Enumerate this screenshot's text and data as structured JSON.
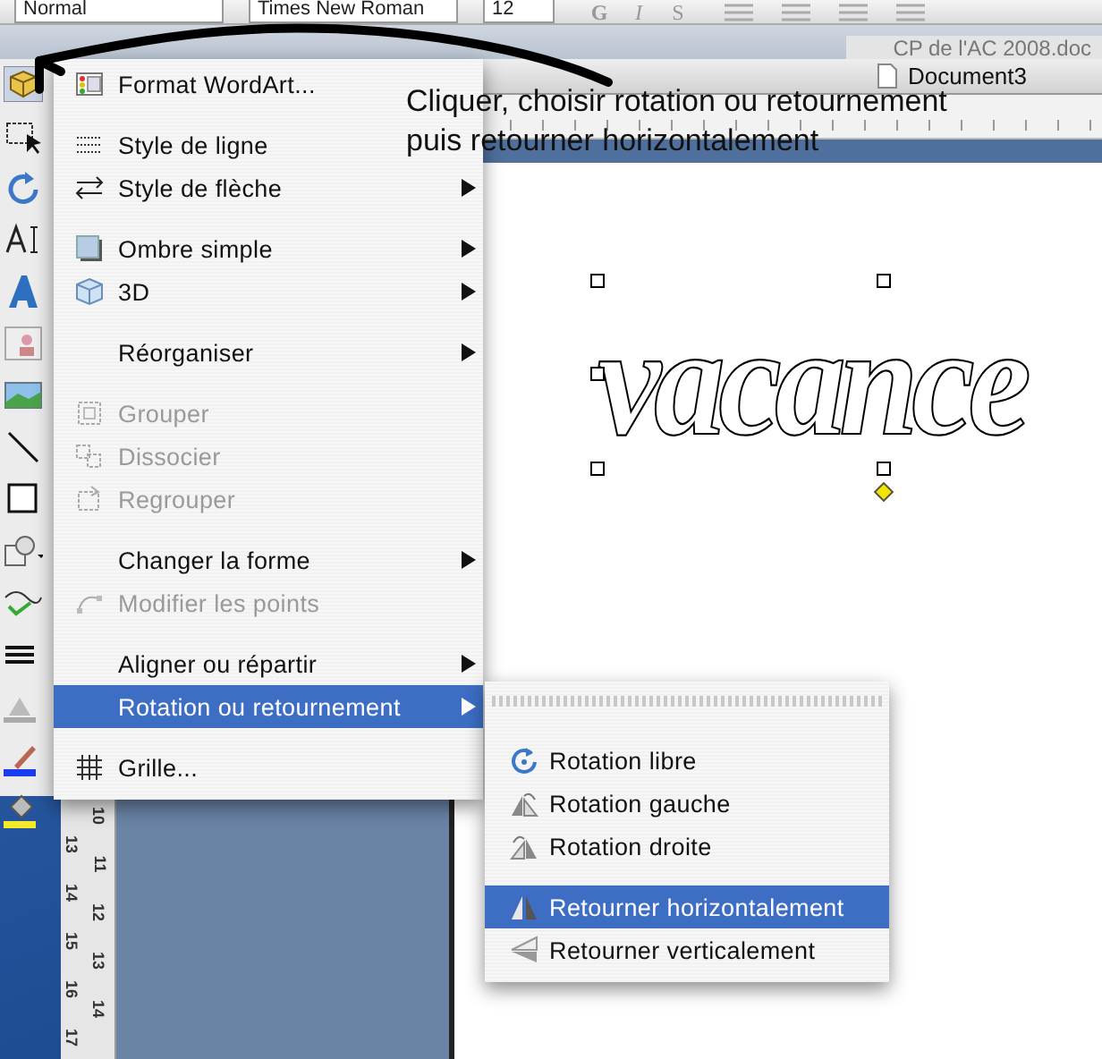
{
  "toolbar": {
    "style_field": "Normal",
    "font_field": "Times New Roman",
    "size_field": "12",
    "format_buttons": [
      "G",
      "I",
      "S"
    ]
  },
  "back_window": {
    "title": "CP de l'AC 2008.doc"
  },
  "document_window": {
    "title": "Document3"
  },
  "annotation": [
    "Cliquer, choisir rotation ou retournement",
    "puis retourner horizontalement"
  ],
  "wordart": {
    "text": "vacance"
  },
  "vertical_ruler": {
    "outer": [
      "13",
      "14",
      "15",
      "16",
      "17"
    ],
    "inner": [
      "10",
      "11",
      "12",
      "13",
      "14"
    ]
  },
  "menu": {
    "groups": [
      [
        {
          "label": "Format WordArt...",
          "disabled": false,
          "selected": false,
          "submenu": false
        }
      ],
      [
        {
          "label": "Style de ligne",
          "disabled": false,
          "selected": false,
          "submenu": false
        },
        {
          "label": "Style de flèche",
          "disabled": false,
          "selected": false,
          "submenu": true
        }
      ],
      [
        {
          "label": "Ombre simple",
          "disabled": false,
          "selected": false,
          "submenu": true
        },
        {
          "label": "3D",
          "disabled": false,
          "selected": false,
          "submenu": true
        }
      ],
      [
        {
          "label": "Réorganiser",
          "disabled": false,
          "selected": false,
          "submenu": true
        }
      ],
      [
        {
          "label": "Grouper",
          "disabled": true,
          "selected": false,
          "submenu": false
        },
        {
          "label": "Dissocier",
          "disabled": true,
          "selected": false,
          "submenu": false
        },
        {
          "label": "Regrouper",
          "disabled": true,
          "selected": false,
          "submenu": false
        }
      ],
      [
        {
          "label": "Changer la forme",
          "disabled": false,
          "selected": false,
          "submenu": true
        },
        {
          "label": "Modifier les points",
          "disabled": true,
          "selected": false,
          "submenu": false
        }
      ],
      [
        {
          "label": "Aligner ou répartir",
          "disabled": false,
          "selected": false,
          "submenu": true
        },
        {
          "label": "Rotation ou retournement",
          "disabled": false,
          "selected": true,
          "submenu": true
        }
      ],
      [
        {
          "label": "Grille...",
          "disabled": false,
          "selected": false,
          "submenu": false
        }
      ]
    ]
  },
  "submenu": {
    "groups": [
      [
        {
          "label": "Rotation libre",
          "disabled": false,
          "selected": false,
          "submenu": false
        },
        {
          "label": "Rotation gauche",
          "disabled": false,
          "selected": false,
          "submenu": false
        },
        {
          "label": "Rotation droite",
          "disabled": false,
          "selected": false,
          "submenu": false
        }
      ],
      [
        {
          "label": "Retourner horizontalement",
          "disabled": false,
          "selected": true,
          "submenu": false
        },
        {
          "label": "Retourner verticalement",
          "disabled": false,
          "selected": false,
          "submenu": false
        }
      ]
    ]
  }
}
